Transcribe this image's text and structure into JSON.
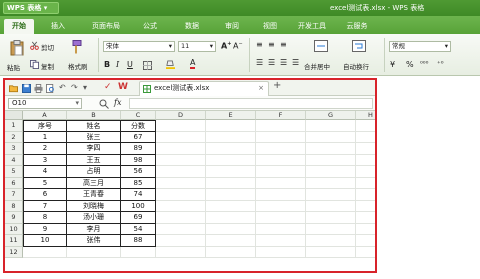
{
  "app": {
    "name": "WPS 表格",
    "window_title": "excel测试表.xlsx - WPS 表格"
  },
  "tabs": [
    "开始",
    "插入",
    "页面布局",
    "公式",
    "数据",
    "审阅",
    "视图",
    "开发工具",
    "云服务"
  ],
  "ribbon": {
    "paste": "粘贴",
    "cut": "剪切",
    "copy": "复制",
    "format_painter": "格式刷",
    "font_name": "宋体",
    "font_size": "11",
    "merge_center": "合并居中",
    "wrap_text": "自动换行",
    "number_format": "常规",
    "percent": "%"
  },
  "document": {
    "tab_name": "excel测试表.xlsx",
    "name_box": "O10",
    "fx": "fx"
  },
  "grid": {
    "columns": [
      "A",
      "B",
      "C",
      "D",
      "E",
      "F",
      "G",
      "H"
    ],
    "rows": [
      "1",
      "2",
      "3",
      "4",
      "5",
      "6",
      "7",
      "8",
      "9",
      "10",
      "11",
      "12"
    ],
    "header": [
      "序号",
      "姓名",
      "分数"
    ],
    "data": [
      [
        "1",
        "张三",
        "67"
      ],
      [
        "2",
        "李四",
        "89"
      ],
      [
        "3",
        "王五",
        "98"
      ],
      [
        "4",
        "占明",
        "56"
      ],
      [
        "5",
        "高三月",
        "85"
      ],
      [
        "6",
        "王青春",
        "74"
      ],
      [
        "7",
        "刘晓梅",
        "100"
      ],
      [
        "8",
        "汤小珊",
        "69"
      ],
      [
        "9",
        "李月",
        "54"
      ],
      [
        "10",
        "张伟",
        "88"
      ]
    ]
  },
  "colors": {
    "accent": "#4f9a33",
    "highlight": "#d8232a"
  }
}
